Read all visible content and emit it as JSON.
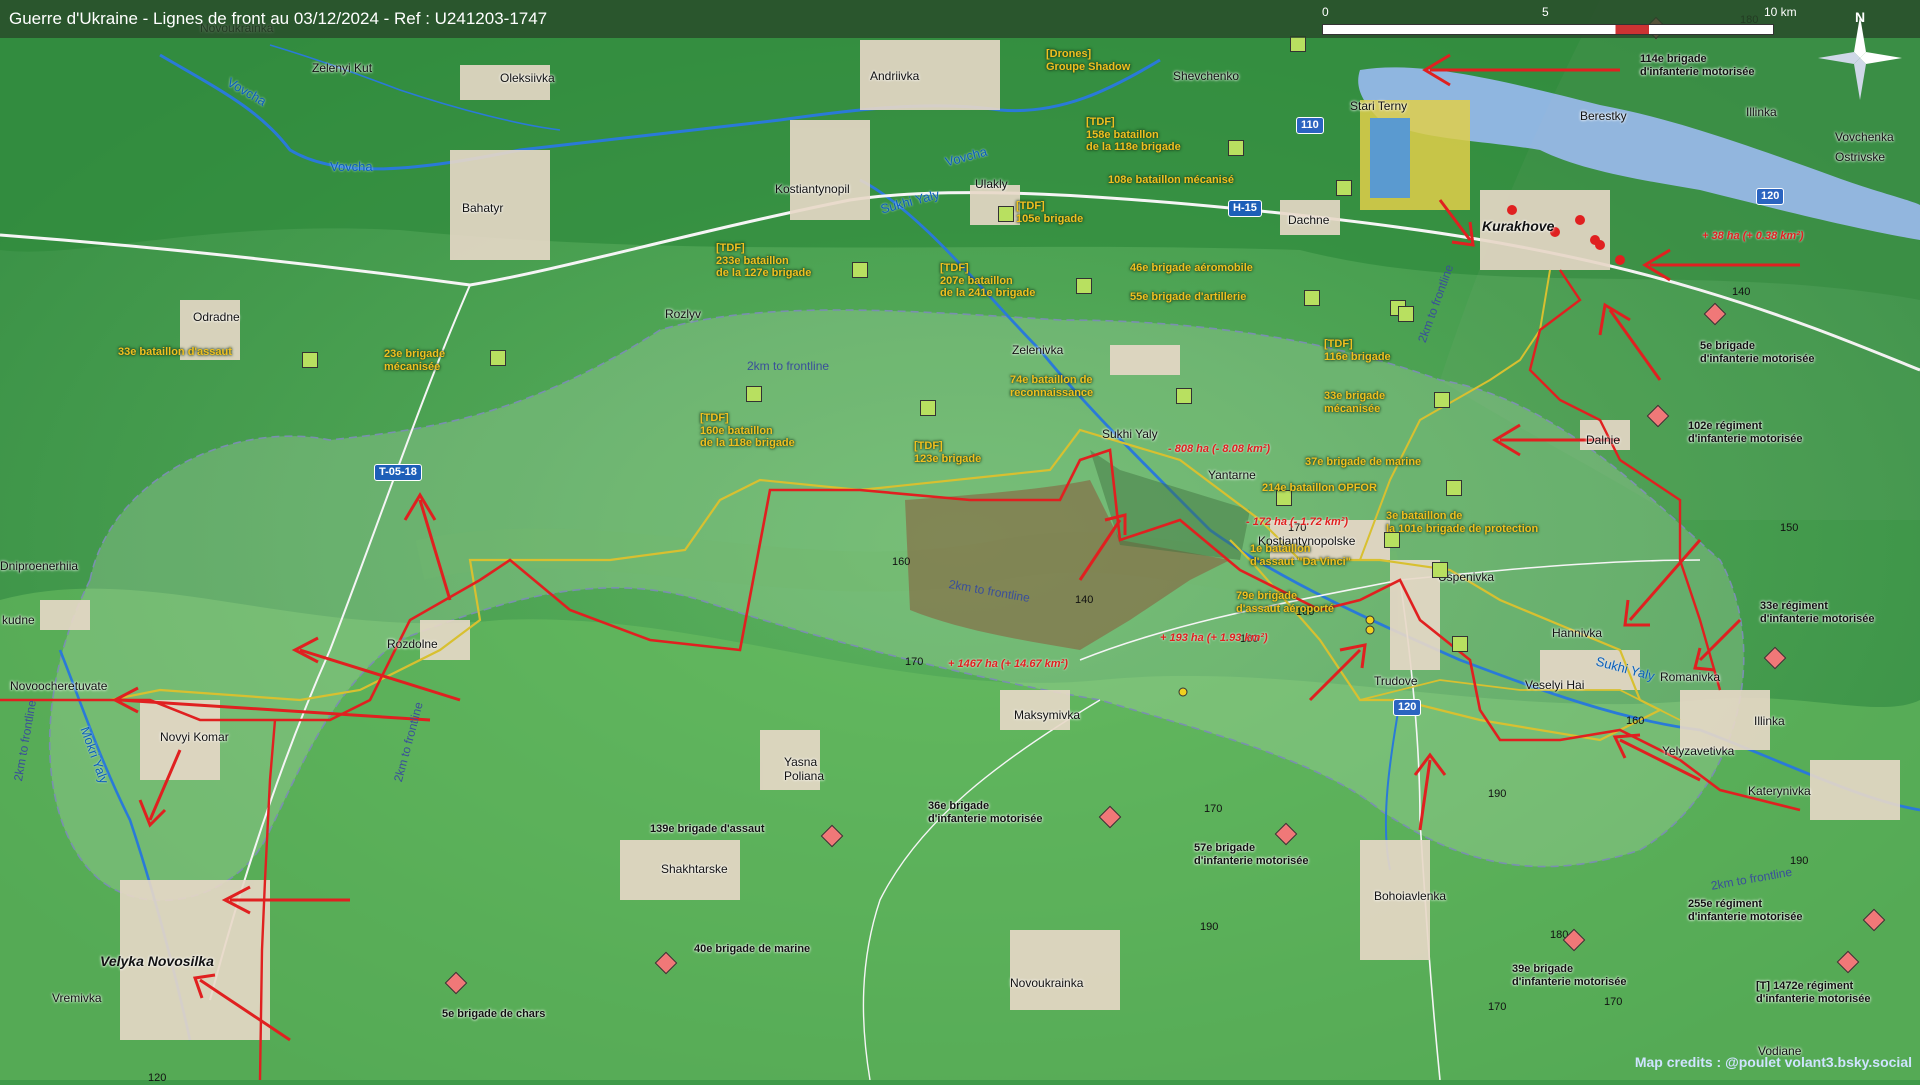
{
  "title": "Guerre d'Ukraine - Lignes de front au 03/12/2024 - Ref : U241203-1747",
  "credit": "Map credits : @poulet volant3.bsky.social",
  "scale": {
    "ticks": [
      "0",
      "5",
      "10 km"
    ]
  },
  "compass": {
    "label": "N"
  },
  "colors": {
    "frontline": "#e02020",
    "old_frontline": "#d8c030",
    "gain_area": "#8a5a3a",
    "ua_unit": "#b8e060",
    "ru_unit": "#f07878",
    "water": "#8fb6e0",
    "river": "#2a7ad8",
    "roads": "#f5f5f5",
    "label_ua": "#f0c020",
    "town": "#e8d8c8"
  },
  "towns": [
    {
      "id": "novoukrainka-n",
      "label": "Novoukrainka"
    },
    {
      "id": "zelenyi-kut",
      "label": "Zelenyi Kut"
    },
    {
      "id": "oleksiivka",
      "label": "Oleksiivka"
    },
    {
      "id": "andriivka",
      "label": "Andriivka"
    },
    {
      "id": "shevchenko",
      "label": "Shevchenko"
    },
    {
      "id": "stari-terny",
      "label": "Stari Terny"
    },
    {
      "id": "berestky",
      "label": "Berestky"
    },
    {
      "id": "illinka-ne",
      "label": "Illinka"
    },
    {
      "id": "vovchenka",
      "label": "Vovchenka"
    },
    {
      "id": "ostrivske",
      "label": "Ostrivske"
    },
    {
      "id": "bahatyr",
      "label": "Bahatyr"
    },
    {
      "id": "kostiantynopil",
      "label": "Kostiantynopil"
    },
    {
      "id": "ulakly",
      "label": "Ulakly"
    },
    {
      "id": "dachne",
      "label": "Dachne"
    },
    {
      "id": "kurakhove",
      "label": "Kurakhove"
    },
    {
      "id": "odradne",
      "label": "Odradne"
    },
    {
      "id": "rozlyv",
      "label": "Rozlyv"
    },
    {
      "id": "zelenivka",
      "label": "Zelenivka"
    },
    {
      "id": "sukhi-yaly",
      "label": "Sukhi Yaly"
    },
    {
      "id": "yantarne",
      "label": "Yantarne"
    },
    {
      "id": "dalnie",
      "label": "Dalnie"
    },
    {
      "id": "kostiantynopolske",
      "label": "Kostiantynopolske"
    },
    {
      "id": "uspenivka",
      "label": "Uspenivka"
    },
    {
      "id": "dniproenerhiia",
      "label": "Dniproenerhiia"
    },
    {
      "id": "rozdolne",
      "label": "Rozdolne"
    },
    {
      "id": "kudne",
      "label": "kudne"
    },
    {
      "id": "novoocheretuvate",
      "label": "Novoocheretuvate"
    },
    {
      "id": "novyi-komar",
      "label": "Novyi Komar"
    },
    {
      "id": "hannivka",
      "label": "Hannivka"
    },
    {
      "id": "veselyi-hai",
      "label": "Veselyi Hai"
    },
    {
      "id": "trudove",
      "label": "Trudove"
    },
    {
      "id": "romanivka",
      "label": "Romanivka"
    },
    {
      "id": "illinka-e",
      "label": "Illinka"
    },
    {
      "id": "yelyzavetivka",
      "label": "Yelyzavetivka"
    },
    {
      "id": "katerynivka",
      "label": "Katerynivka"
    },
    {
      "id": "maksymivka",
      "label": "Maksymivka"
    },
    {
      "id": "yasna-poliana",
      "label": "Yasna\nPoliana"
    },
    {
      "id": "shakhtarske",
      "label": "Shakhtarske"
    },
    {
      "id": "velyka-novosilka",
      "label": "Velyka Novosilka"
    },
    {
      "id": "vremivka",
      "label": "Vremivka"
    },
    {
      "id": "novoukrainka-s",
      "label": "Novoukrainka"
    },
    {
      "id": "bohoiavlenka",
      "label": "Bohoiavlenka"
    },
    {
      "id": "vodiane",
      "label": "Vodiane"
    }
  ],
  "rivers": [
    "Vovcha",
    "Vovcha",
    "Vovcha",
    "Sukhi Yaly",
    "Sukhi Yaly",
    "Mokri Yaly"
  ],
  "roads": [
    "H-15",
    "T-05-18",
    "110",
    "120",
    "120"
  ],
  "elevations": [
    "180",
    "140",
    "160",
    "140",
    "170",
    "170",
    "160",
    "180",
    "150",
    "160",
    "170",
    "190",
    "170",
    "170",
    "180",
    "190",
    "120",
    "190"
  ],
  "buffer_labels": [
    "2km to frontline",
    "2km to frontline",
    "2km to frontline",
    "2km to frontline",
    "2km to frontline",
    "2km to frontline"
  ],
  "area_changes": [
    "+ 1467 ha (+ 14.67 km²)",
    "- 808 ha (- 8.08 km²)",
    "- 172 ha (- 1.72 km²)",
    "+ 193 ha (+ 1.93 km²)",
    "+ 38 ha (+ 0.38 km²)"
  ],
  "ua_units": [
    "[Drones]\nGroupe Shadow",
    "[TDF]\n158e bataillon\nde la 118e brigade",
    "108e bataillon mécanisé",
    "[TDF]\n105e brigade",
    "[TDF]\n233e bataillon\nde la 127e brigade",
    "[TDF]\n207e bataillon\nde la 241e brigade",
    "46e brigade aéromobile",
    "55e brigade d'artillerie",
    "33e bataillon d'assaut",
    "23e brigade\nmécanisée",
    "[TDF]\n116e brigade",
    "74e bataillon de\nreconnaissance",
    "33e brigade\nmécanisée",
    "[TDF]\n160e bataillon\nde la 118e brigade",
    "[TDF]\n123e brigade",
    "37e brigade de marine",
    "214e bataillon OPFOR",
    "3e bataillon de\nla 101e brigade de protection",
    "1e bataillon\nd'assaut \"Da Vinci\"",
    "79e brigade\nd'assaut aéroporté"
  ],
  "ru_units": [
    "114e brigade\nd'infanterie motorisée",
    "5e brigade\nd'infanterie motorisée",
    "102e régiment\nd'infanterie motorisée",
    "33e régiment\nd'infanterie motorisée",
    "36e brigade\nd'infanterie motorisée",
    "139e brigade d'assaut",
    "57e brigade\nd'infanterie motorisée",
    "40e brigade de marine",
    "5e brigade de chars",
    "255e régiment\nd'infanterie motorisée",
    "39e brigade\nd'infanterie motorisée",
    "[T] 1472e régiment\nd'infanterie motorisée"
  ]
}
